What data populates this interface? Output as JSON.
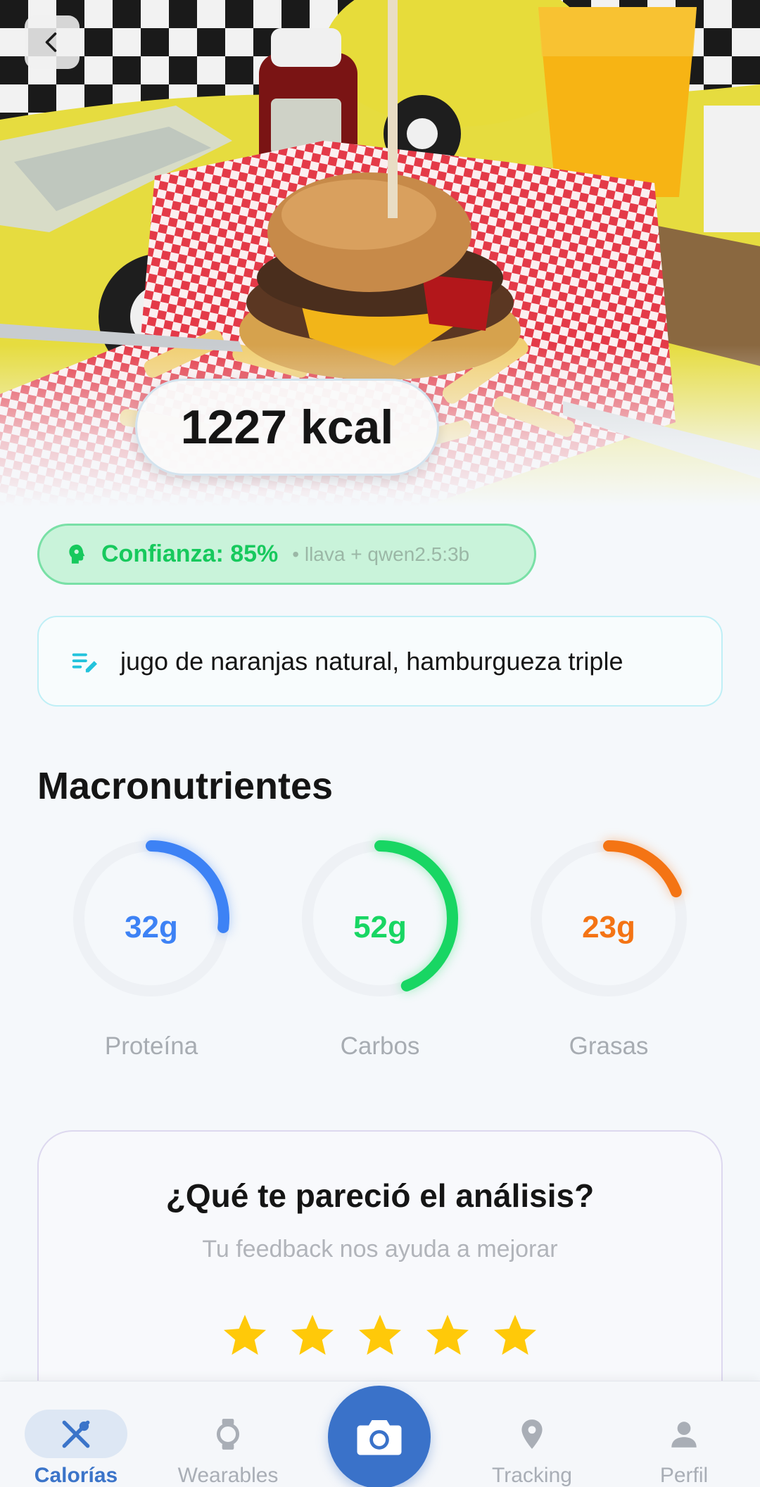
{
  "hero": {
    "photo_description_icon": "burger-photo",
    "kcal_label": "1227 kcal"
  },
  "confidence": {
    "label": "Confianza: 85%",
    "model": "• llava + qwen2.5:3b"
  },
  "description": {
    "text": "jugo de naranjas natural, hamburgueza triple"
  },
  "macros": {
    "title": "Macronutrientes",
    "items": [
      {
        "value": "32g",
        "label": "Proteína",
        "fraction": 0.27,
        "color": "#3d82f5"
      },
      {
        "value": "52g",
        "label": "Carbos",
        "fraction": 0.44,
        "color": "#18d663"
      },
      {
        "value": "23g",
        "label": "Grasas",
        "fraction": 0.19,
        "color": "#f47414"
      }
    ]
  },
  "feedback": {
    "title": "¿Qué te pareció el análisis?",
    "subtitle": "Tu feedback nos ayuda a mejorar",
    "stars": 5,
    "star_color": "#ffc909"
  },
  "nav": {
    "items": [
      {
        "label": "Calorías",
        "icon": "fork-spoon-icon",
        "active": true
      },
      {
        "label": "Wearables",
        "icon": "watch-icon",
        "active": false
      },
      {
        "label": "",
        "icon": "camera-icon",
        "active": false
      },
      {
        "label": "Tracking",
        "icon": "location-pin-icon",
        "active": false
      },
      {
        "label": "Perfil",
        "icon": "person-icon",
        "active": false
      }
    ]
  },
  "colors": {
    "accent": "#3a72c9",
    "confidence_green": "#17c95d"
  }
}
